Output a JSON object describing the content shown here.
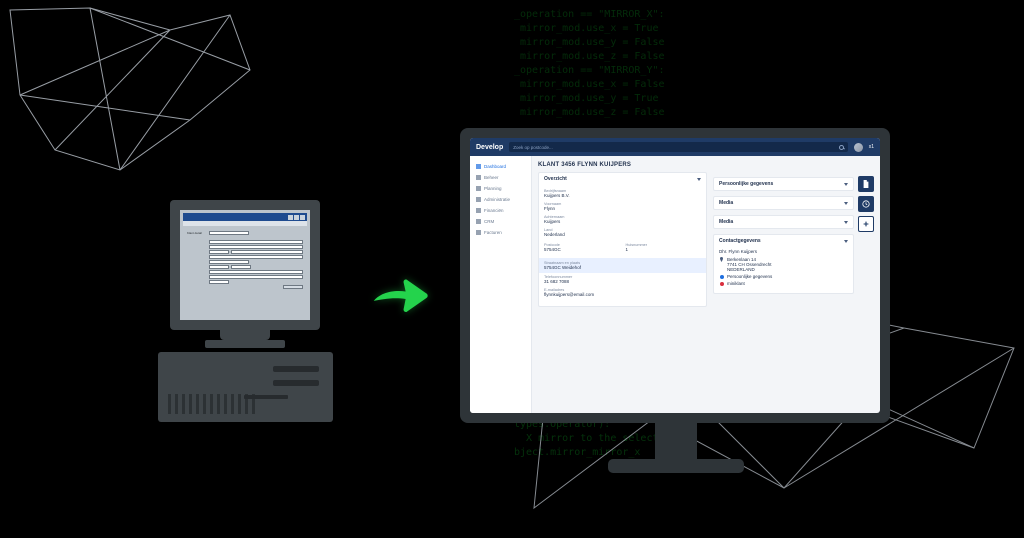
{
  "bg_code_top": "_operation == \"MIRROR_X\":\n mirror_mod.use_x = True\n mirror_mod.use_y = False\n mirror_mod.use_z = False\n_operation == \"MIRROR_Y\":\n mirror_mod.use_x = False\n mirror_mod.use_y = True\n mirror_mod.use_z = False",
  "bg_code_bottom": "types.Operator):\n  X mirror to the selected\nbject.mirror_mirror_x",
  "arrow_color": "#24d34c",
  "old_ui": {
    "top_label": "Klant detail"
  },
  "app": {
    "brand": "Develop",
    "search_placeholder": "Zoek op postcode...",
    "scale": "x1",
    "sidebar": [
      {
        "label": "Dashboard",
        "active": true
      },
      {
        "label": "Beheer",
        "active": false
      },
      {
        "label": "Planning",
        "active": false
      },
      {
        "label": "Administratie",
        "active": false
      },
      {
        "label": "Financiën",
        "active": false
      },
      {
        "label": "CRM",
        "active": false
      },
      {
        "label": "Facturen",
        "active": false
      }
    ],
    "page_title": "KLANT 3456 FLYNN KUIJPERS",
    "overview": {
      "title": "Overzicht",
      "fields": [
        {
          "k": "Bedrijfsnaam",
          "v": "Kuijpers B.V."
        },
        {
          "k": "Voornaam",
          "v": "Flynn"
        },
        {
          "k": "Achternaam",
          "v": "Kuijpers"
        },
        {
          "k": "Land",
          "v": "Nederland"
        }
      ],
      "postcode": {
        "k": "Postcode",
        "v": "5754GC"
      },
      "huisnummer": {
        "k": "Huisnummer",
        "v": "1"
      },
      "highlight": {
        "k": "Straatnaam en plaats",
        "v": "5754GC Weidehof"
      },
      "telefoon": {
        "k": "Telefoonnummer",
        "v": "31 682 7088"
      },
      "email": {
        "k": "E-mailadres",
        "v": "flynnkuijpers@email.com"
      }
    },
    "cards": {
      "persoonlijke": "Persoonlijke gegevens",
      "media1": "Media",
      "media2": "Media",
      "contact": {
        "title": "Contactgegevens",
        "name": "Dhr. Flynn Kuijpers",
        "address_lines": [
          "Berkenlaan 14",
          "7741 CH Ossendrecht",
          "NEDERLAND"
        ],
        "social1": "Persoonlijke gegevens",
        "social2": "miniklant"
      }
    },
    "actions": [
      "document-icon",
      "clock-icon",
      "plus-icon"
    ]
  }
}
